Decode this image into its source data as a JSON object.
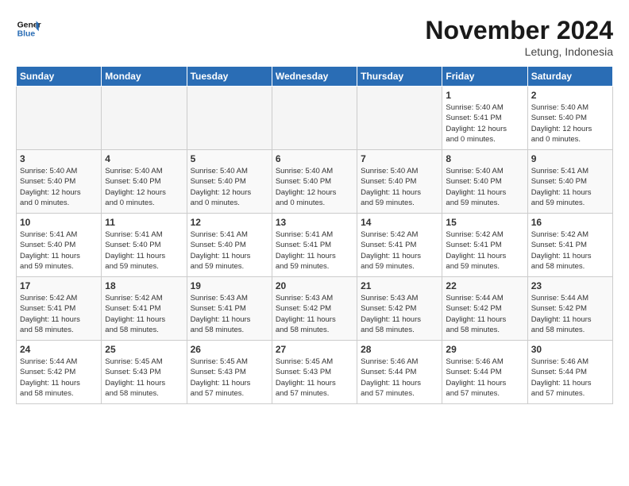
{
  "logo": {
    "line1": "General",
    "line2": "Blue"
  },
  "title": "November 2024",
  "subtitle": "Letung, Indonesia",
  "days_header": [
    "Sunday",
    "Monday",
    "Tuesday",
    "Wednesday",
    "Thursday",
    "Friday",
    "Saturday"
  ],
  "weeks": [
    [
      {
        "day": "",
        "info": ""
      },
      {
        "day": "",
        "info": ""
      },
      {
        "day": "",
        "info": ""
      },
      {
        "day": "",
        "info": ""
      },
      {
        "day": "",
        "info": ""
      },
      {
        "day": "1",
        "info": "Sunrise: 5:40 AM\nSunset: 5:41 PM\nDaylight: 12 hours\nand 0 minutes."
      },
      {
        "day": "2",
        "info": "Sunrise: 5:40 AM\nSunset: 5:40 PM\nDaylight: 12 hours\nand 0 minutes."
      }
    ],
    [
      {
        "day": "3",
        "info": "Sunrise: 5:40 AM\nSunset: 5:40 PM\nDaylight: 12 hours\nand 0 minutes."
      },
      {
        "day": "4",
        "info": "Sunrise: 5:40 AM\nSunset: 5:40 PM\nDaylight: 12 hours\nand 0 minutes."
      },
      {
        "day": "5",
        "info": "Sunrise: 5:40 AM\nSunset: 5:40 PM\nDaylight: 12 hours\nand 0 minutes."
      },
      {
        "day": "6",
        "info": "Sunrise: 5:40 AM\nSunset: 5:40 PM\nDaylight: 12 hours\nand 0 minutes."
      },
      {
        "day": "7",
        "info": "Sunrise: 5:40 AM\nSunset: 5:40 PM\nDaylight: 11 hours\nand 59 minutes."
      },
      {
        "day": "8",
        "info": "Sunrise: 5:40 AM\nSunset: 5:40 PM\nDaylight: 11 hours\nand 59 minutes."
      },
      {
        "day": "9",
        "info": "Sunrise: 5:41 AM\nSunset: 5:40 PM\nDaylight: 11 hours\nand 59 minutes."
      }
    ],
    [
      {
        "day": "10",
        "info": "Sunrise: 5:41 AM\nSunset: 5:40 PM\nDaylight: 11 hours\nand 59 minutes."
      },
      {
        "day": "11",
        "info": "Sunrise: 5:41 AM\nSunset: 5:40 PM\nDaylight: 11 hours\nand 59 minutes."
      },
      {
        "day": "12",
        "info": "Sunrise: 5:41 AM\nSunset: 5:40 PM\nDaylight: 11 hours\nand 59 minutes."
      },
      {
        "day": "13",
        "info": "Sunrise: 5:41 AM\nSunset: 5:41 PM\nDaylight: 11 hours\nand 59 minutes."
      },
      {
        "day": "14",
        "info": "Sunrise: 5:42 AM\nSunset: 5:41 PM\nDaylight: 11 hours\nand 59 minutes."
      },
      {
        "day": "15",
        "info": "Sunrise: 5:42 AM\nSunset: 5:41 PM\nDaylight: 11 hours\nand 59 minutes."
      },
      {
        "day": "16",
        "info": "Sunrise: 5:42 AM\nSunset: 5:41 PM\nDaylight: 11 hours\nand 58 minutes."
      }
    ],
    [
      {
        "day": "17",
        "info": "Sunrise: 5:42 AM\nSunset: 5:41 PM\nDaylight: 11 hours\nand 58 minutes."
      },
      {
        "day": "18",
        "info": "Sunrise: 5:42 AM\nSunset: 5:41 PM\nDaylight: 11 hours\nand 58 minutes."
      },
      {
        "day": "19",
        "info": "Sunrise: 5:43 AM\nSunset: 5:41 PM\nDaylight: 11 hours\nand 58 minutes."
      },
      {
        "day": "20",
        "info": "Sunrise: 5:43 AM\nSunset: 5:42 PM\nDaylight: 11 hours\nand 58 minutes."
      },
      {
        "day": "21",
        "info": "Sunrise: 5:43 AM\nSunset: 5:42 PM\nDaylight: 11 hours\nand 58 minutes."
      },
      {
        "day": "22",
        "info": "Sunrise: 5:44 AM\nSunset: 5:42 PM\nDaylight: 11 hours\nand 58 minutes."
      },
      {
        "day": "23",
        "info": "Sunrise: 5:44 AM\nSunset: 5:42 PM\nDaylight: 11 hours\nand 58 minutes."
      }
    ],
    [
      {
        "day": "24",
        "info": "Sunrise: 5:44 AM\nSunset: 5:42 PM\nDaylight: 11 hours\nand 58 minutes."
      },
      {
        "day": "25",
        "info": "Sunrise: 5:45 AM\nSunset: 5:43 PM\nDaylight: 11 hours\nand 58 minutes."
      },
      {
        "day": "26",
        "info": "Sunrise: 5:45 AM\nSunset: 5:43 PM\nDaylight: 11 hours\nand 57 minutes."
      },
      {
        "day": "27",
        "info": "Sunrise: 5:45 AM\nSunset: 5:43 PM\nDaylight: 11 hours\nand 57 minutes."
      },
      {
        "day": "28",
        "info": "Sunrise: 5:46 AM\nSunset: 5:44 PM\nDaylight: 11 hours\nand 57 minutes."
      },
      {
        "day": "29",
        "info": "Sunrise: 5:46 AM\nSunset: 5:44 PM\nDaylight: 11 hours\nand 57 minutes."
      },
      {
        "day": "30",
        "info": "Sunrise: 5:46 AM\nSunset: 5:44 PM\nDaylight: 11 hours\nand 57 minutes."
      }
    ]
  ]
}
